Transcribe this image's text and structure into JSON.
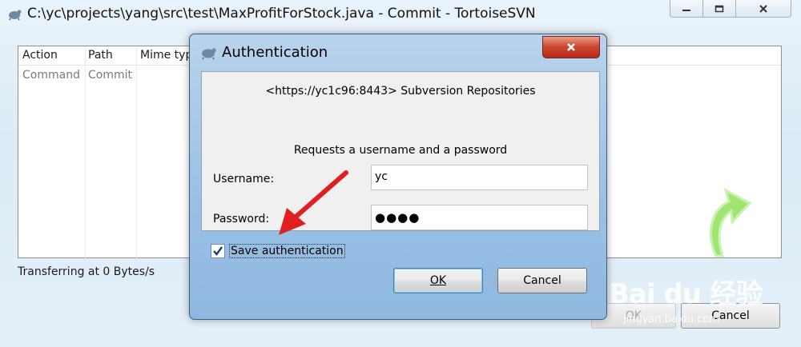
{
  "main_window": {
    "title": "C:\\yc\\projects\\yang\\src\\test\\MaxProfitForStock.java - Commit - TortoiseSVN",
    "columns": [
      "Action",
      "Path",
      "Mime typ"
    ],
    "rows": [
      {
        "action": "Command",
        "path": "Commit"
      }
    ],
    "status": "Transferring at 0 Bytes/s",
    "ok_label": "OK",
    "cancel_label": "Cancel"
  },
  "auth_dialog": {
    "title": "Authentication",
    "realm": "<https://yc1c96:8443> Subversion Repositories",
    "request": "Requests a username and a password",
    "username_label": "Username:",
    "username_value": "yc",
    "password_label": "Password:",
    "password_value": "●●●●",
    "save_auth_label": "Save authentication",
    "save_auth_checked": true,
    "ok_label": "OK",
    "cancel_label": "Cancel"
  },
  "watermark": {
    "brand": "Bai  du 经验",
    "url": "jingyan.baidu.com"
  },
  "colors": {
    "dialog_frame": "#9cc1e5",
    "close_button": "#cf4a32",
    "annotation_arrow": "#e02020",
    "refresh_arrow": "#7ed957"
  },
  "icons": [
    "tortoisesvn-icon",
    "minimize-icon",
    "maximize-icon",
    "close-icon",
    "checkmark-icon",
    "refresh-arrow-icon",
    "annotation-arrow-icon"
  ]
}
